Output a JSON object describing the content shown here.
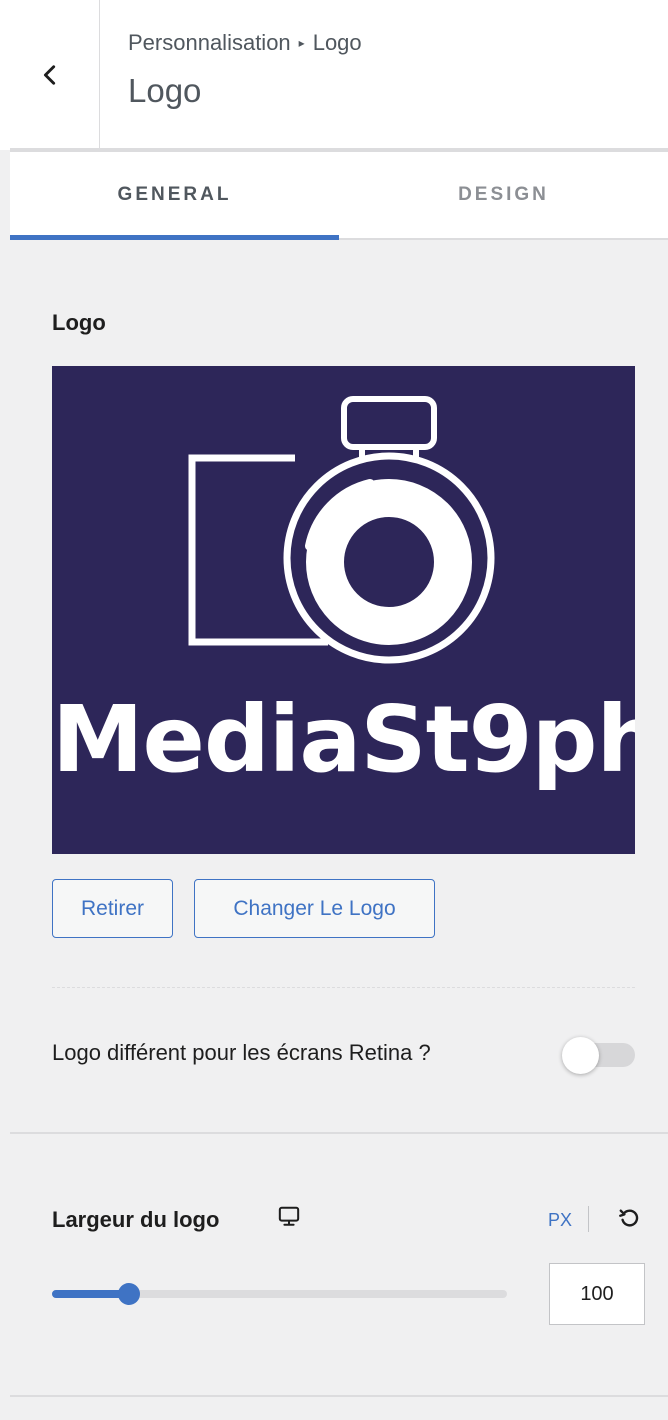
{
  "header": {
    "back_icon": "chevron-left-icon",
    "breadcrumb": {
      "parent": "Personnalisation",
      "current": "Logo"
    },
    "title": "Logo"
  },
  "tabs": [
    {
      "label": "GENERAL",
      "active": true
    },
    {
      "label": "DESIGN",
      "active": false
    }
  ],
  "logo_section": {
    "label": "Logo",
    "logo_wordmark": "MediaSt9ph",
    "logo_background": "#2d2659",
    "buttons": {
      "remove": "Retirer",
      "change": "Changer Le Logo"
    }
  },
  "retina": {
    "label": "Logo différent pour les écrans Retina ?",
    "enabled": false
  },
  "logo_width": {
    "label": "Largeur du logo",
    "device_icon": "desktop-monitor-icon",
    "unit": "PX",
    "reset_icon": "reset-icon",
    "value": "100",
    "slider_fraction": 0.17
  },
  "colors": {
    "accent": "#3f73c4",
    "panel_bg": "#f0f0f1"
  }
}
